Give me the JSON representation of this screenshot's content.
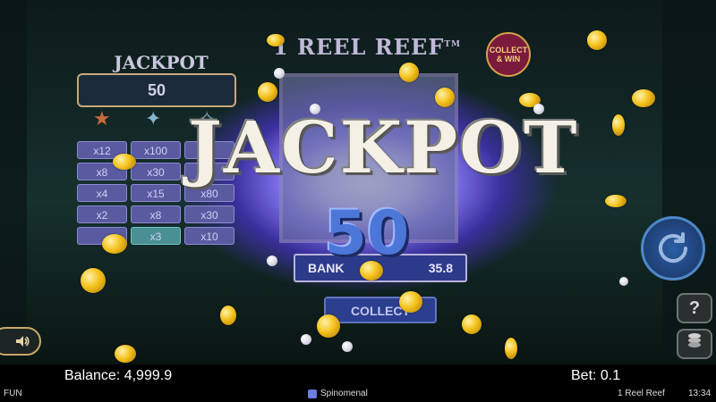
{
  "jackpot_panel": {
    "title": "JACKPOT",
    "value": "50",
    "paytable": [
      [
        "x12",
        "x100",
        "x1"
      ],
      [
        "x8",
        "x30",
        ""
      ],
      [
        "x4",
        "x15",
        "x80"
      ],
      [
        "x2",
        "x8",
        "x30"
      ],
      [
        "",
        "x3",
        "x10"
      ]
    ]
  },
  "game": {
    "title": "1 REEL REEF",
    "trademark": "TM",
    "collect_win_badge": "COLLECT & WIN",
    "bank_label": "BANK",
    "bank_value": "35.8",
    "collect_label": "COLLECT"
  },
  "overlay": {
    "jackpot_text": "JACKPOT",
    "jackpot_amount": "50"
  },
  "controls": {
    "help_label": "?",
    "spin_icon": "refresh-icon",
    "coins_icon": "coin-stack-icon",
    "sound_icon": "speaker-icon"
  },
  "statusbar": {
    "balance": "Balance: 4,999.9",
    "bet": "Bet: 0.1"
  },
  "footer": {
    "mode": "FUN",
    "provider": "Spinomenal",
    "game_name": "1 Reel Reef",
    "time": "13:34"
  },
  "colors": {
    "gold": "#f4c21c",
    "jackpot_blue": "#4c77d8",
    "glow": "#7c6fe8"
  }
}
